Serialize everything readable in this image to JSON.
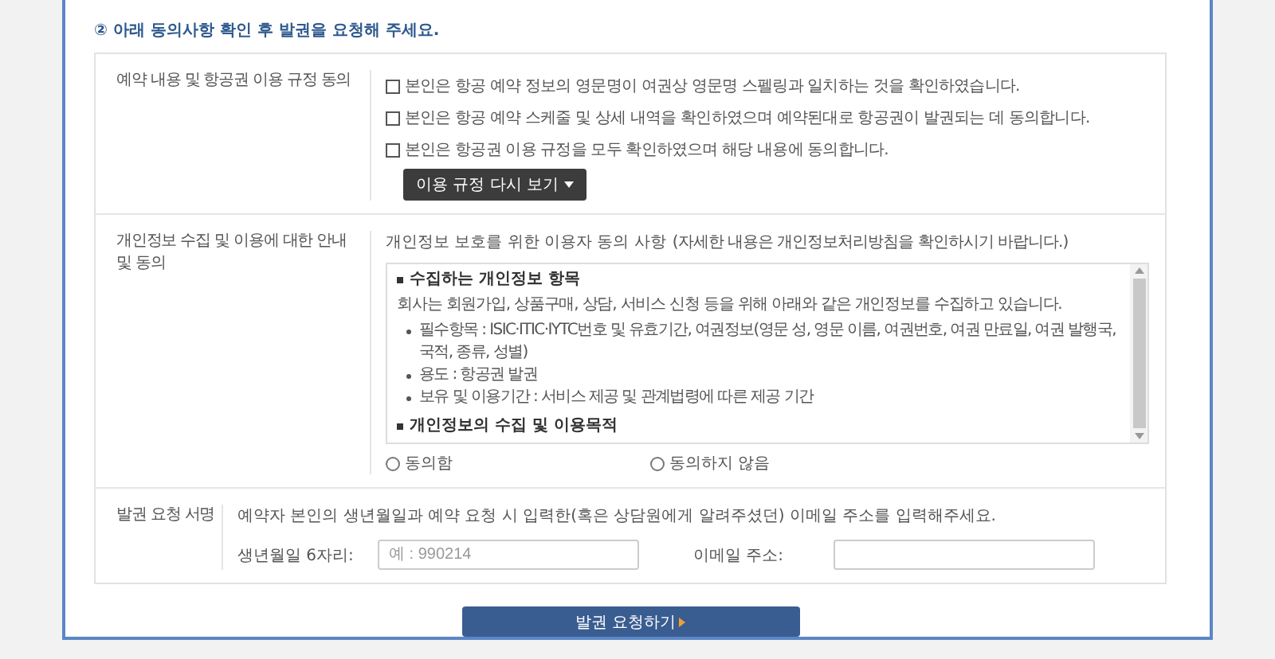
{
  "heading": "② 아래 동의사항 확인 후 발권을 요청해 주세요.",
  "sections": [
    {
      "kind": "checks",
      "label": "예약 내용 및 항공권 이용 규정 동의",
      "items": [
        {
          "text": "본인은 항공 예약 정보의 영문명이 여권상 영문명 스펠링과 일치하는 것을 확인하였습니다.",
          "checked": false
        },
        {
          "text": "본인은 항공 예약 스케줄 및 상세 내역을 확인하였으며 예약된대로 항공권이 발권되는 데 동의합니다.",
          "checked": false
        },
        {
          "text": "본인은 항공권 이용 규정을 모두 확인하였으며 해당 내용에 동의합니다.",
          "checked": false
        }
      ],
      "button": "이용 규정 다시 보기"
    },
    {
      "kind": "privacy",
      "label": "개인정보 수집 및 이용에 대한 안내 및 동의",
      "intro": "개인정보 보호를 위한 이용자 동의 사항",
      "note": "(자세한 내용은 개인정보처리방침을 확인하시기 바랍니다.)",
      "terms": {
        "heading": "수집하는 개인정보 항목",
        "text": "회사는 회원가입, 상품구매, 상담, 서비스 신청 등을 위해 아래와 같은 개인정보를 수집하고 있습니다.",
        "bullets": [
          "필수항목 : ISIC·ITIC·IYTC번호 및 유효기간, 여권정보(영문 성, 영문 이름, 여권번호, 여권 만료일, 여권 발행국, 국적, 종류, 성별)",
          "용도 : 항공권 발권",
          "보유 및 이용기간 : 서비스 제공 및 관계법령에 따른 제공 기간"
        ],
        "heading2": "개인정보의 수집 및 이용목적"
      },
      "options": [
        {
          "label": "동의함",
          "selected": false
        },
        {
          "label": "동의하지 않음",
          "selected": false
        }
      ]
    },
    {
      "kind": "signature",
      "label": "발권 요청 서명",
      "intro": "예약자 본인의 생년월일과 예약 요청 시 입력한(혹은 상담원에게 알려주셨던) 이메일 주소를 입력해주세요.",
      "fields": [
        {
          "label": "생년월일 6자리:",
          "placeholder": "예 : 990214"
        },
        {
          "label": "이메일 주소:"
        }
      ]
    }
  ],
  "submit": "발권 요청하기"
}
